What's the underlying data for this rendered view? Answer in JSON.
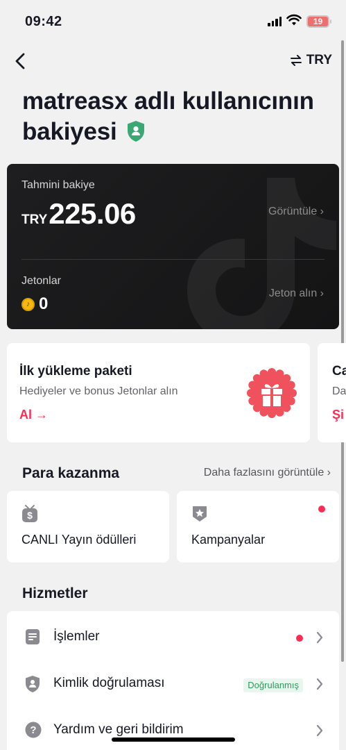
{
  "status_bar": {
    "time": "09:42",
    "battery": "19"
  },
  "header": {
    "currency": "TRY"
  },
  "page": {
    "title": "matreasx adlı kullanıcının bakiyesi"
  },
  "balance_card": {
    "label": "Tahmini bakiye",
    "currency": "TRY",
    "amount": "225.06",
    "view_link": "Görüntüle ›",
    "coins_label": "Jetonlar",
    "coins_value": "0",
    "buy_coins_link": "Jeton alın ›"
  },
  "promos": [
    {
      "title": "İlk yükleme paketi",
      "description": "Hediyeler ve bonus Jetonlar alın",
      "cta": "Al →"
    },
    {
      "title": "Ca",
      "description": "Da",
      "cta": "Şi"
    }
  ],
  "earning": {
    "title": "Para kazanma",
    "see_more": "Daha fazlasını görüntüle ›",
    "tiles": [
      {
        "label": "CANLI Yayın ödülleri",
        "icon": "live-gift-icon"
      },
      {
        "label": "Kampanyalar",
        "icon": "campaign-badge-icon"
      }
    ]
  },
  "services": {
    "title": "Hizmetler",
    "items": [
      {
        "label": "İşlemler",
        "icon": "transactions-icon"
      },
      {
        "label": "Kimlik doğrulaması",
        "icon": "identity-shield-icon",
        "badge": "Doğrulanmış"
      },
      {
        "label": "Yardım ve geri bildirim",
        "icon": "help-icon"
      }
    ]
  },
  "colors": {
    "accent": "#fe2c55",
    "verified": "#2f9a5e",
    "card_bg": "#1e1e20"
  }
}
